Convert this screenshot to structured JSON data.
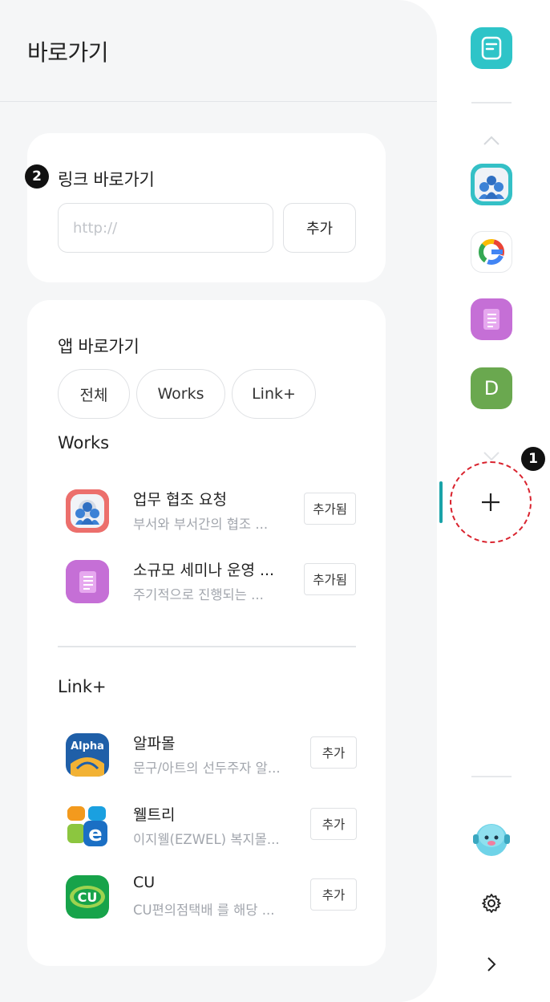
{
  "panel": {
    "title": "바로가기"
  },
  "link_card": {
    "heading": "링크 바로가기",
    "url_placeholder": "http://",
    "add_label": "추가"
  },
  "app_card": {
    "heading": "앱 바로가기",
    "filters": [
      "전체",
      "Works",
      "Link+"
    ],
    "works_section": {
      "label": "Works",
      "items": [
        {
          "name": "업무 협조 요청",
          "desc": "부서와 부서간의 협조 ...",
          "button": "추가됨",
          "icon": "collaboration-icon"
        },
        {
          "name": "소규모 세미나 운영 ...",
          "desc": "주기적으로 진행되는 ...",
          "button": "추가됨",
          "icon": "notepad-icon"
        }
      ]
    },
    "linkplus_section": {
      "label": "Link+",
      "items": [
        {
          "name": "알파몰",
          "desc": "문구/아트의 선두주자 알...",
          "button": "추가",
          "icon": "alpha-logo-icon",
          "logo_text": "Alpha"
        },
        {
          "name": "웰트리",
          "desc": "이지웰(EZWEL) 복지몰...",
          "button": "추가",
          "icon": "ezwel-logo-icon",
          "logo_text": "e"
        },
        {
          "name": "CU",
          "desc": "CU편의점택배 를 해당 ...",
          "button": "추가",
          "icon": "cu-logo-icon",
          "logo_text": "CU"
        }
      ]
    }
  },
  "rail": {
    "icons": [
      "memo-icon",
      "chevron-up-icon",
      "collaboration-icon",
      "google-icon",
      "notepad-icon",
      "profile-d-icon",
      "chevron-down-icon",
      "add-shortcut-icon",
      "character-avatar-icon",
      "gear-icon",
      "chevron-right-icon"
    ],
    "profile_letter": "D",
    "google_letter": "G"
  },
  "annotations": {
    "badge1": "1",
    "badge2": "2"
  },
  "colors": {
    "accent": "#1aa3a8",
    "annotation_red": "#d9232e",
    "memo_teal": "#2ec4c8",
    "notepad_purple": "#c56fd6",
    "profile_green": "#6aa84f"
  }
}
